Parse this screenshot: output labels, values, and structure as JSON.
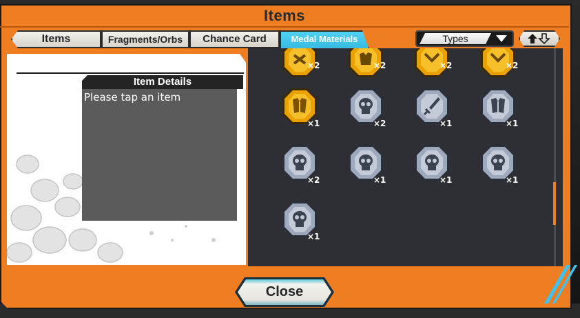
{
  "window": {
    "title": "Items"
  },
  "tabs": [
    {
      "label": "Items",
      "active": false
    },
    {
      "label": "Fragments/Orbs",
      "active": false
    },
    {
      "label": "Chance Card",
      "active": false
    },
    {
      "label": "Medal Materials",
      "active": true
    }
  ],
  "filter": {
    "types_label": "Types"
  },
  "detail": {
    "header": "Item Details",
    "placeholder": "Please tap an item"
  },
  "medals": [
    {
      "kind": "gold-shard",
      "qty": "×2"
    },
    {
      "kind": "gold-armor",
      "qty": "×2"
    },
    {
      "kind": "gold-shield",
      "qty": "×2"
    },
    {
      "kind": "gold-shield",
      "qty": "×2"
    },
    {
      "kind": "gold-armor",
      "qty": "×1"
    },
    {
      "kind": "silver-skull",
      "qty": "×2"
    },
    {
      "kind": "silver-sword",
      "qty": "×1"
    },
    {
      "kind": "silver-armor",
      "qty": "×1"
    },
    {
      "kind": "silver-skull",
      "qty": "×2"
    },
    {
      "kind": "silver-skull",
      "qty": "×1"
    },
    {
      "kind": "silver-skull",
      "qty": "×1"
    },
    {
      "kind": "silver-skull",
      "qty": "×1"
    },
    {
      "kind": "silver-skull",
      "qty": "×1"
    }
  ],
  "colors": {
    "frame": "#ef7d22",
    "active_tab": "#1e9fd0",
    "gold": "#e9a200",
    "silver": "#9ea9bb",
    "panel_dark": "#2d2f34"
  },
  "close_button": {
    "label": "Close"
  }
}
